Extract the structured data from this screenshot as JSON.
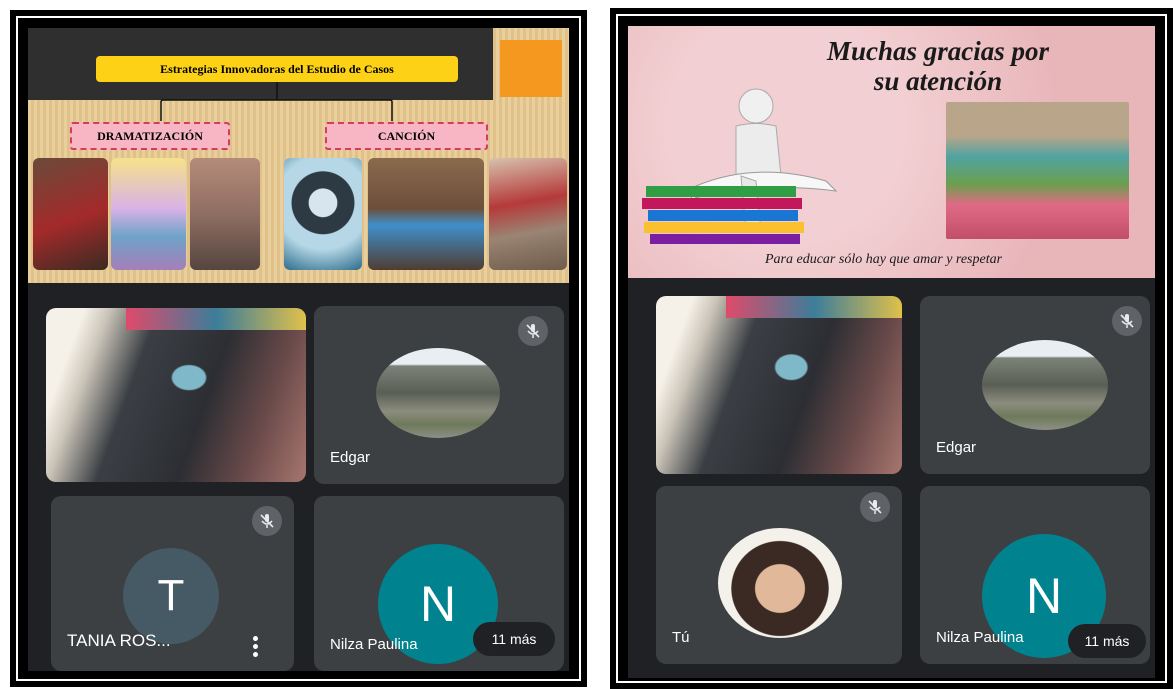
{
  "left_screen": {
    "slide": {
      "title": "Estrategias Innovadoras del Estudio de Casos",
      "tag_left": "DRAMATIZACIÓN",
      "tag_right": "CANCIÓN"
    },
    "tiles": [
      {
        "name": ""
      },
      {
        "name": "Edgar"
      },
      {
        "name": "TANIA ROS...",
        "initial": "T"
      },
      {
        "name": "Nilza Paulina",
        "initial": "N",
        "more": "11 más"
      }
    ]
  },
  "right_screen": {
    "slide": {
      "title_line1": "Muchas gracias por",
      "title_line2": "su atención",
      "footer": "Para educar sólo hay que amar y respetar"
    },
    "tiles": [
      {
        "name": ""
      },
      {
        "name": "Edgar"
      },
      {
        "name": "Tú"
      },
      {
        "name": "Nilza Paulina",
        "initial": "N",
        "more": "11 más"
      }
    ]
  },
  "colors": {
    "meet_bg": "#202124",
    "tile_bg": "#3c4043",
    "avatar_t": "#455a64",
    "avatar_n": "#00838f",
    "slide_title_bar": "#fcd116",
    "tag_pink": "#f8b6c4"
  }
}
